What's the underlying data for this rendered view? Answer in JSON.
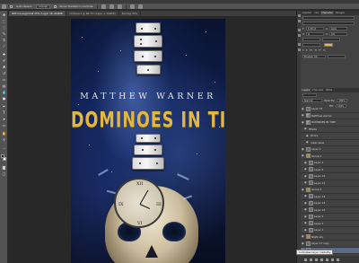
{
  "options_bar": {
    "auto_select_label": "Auto-Select:",
    "auto_select_value": "Group",
    "show_transform_label": "Show Transform Controls"
  },
  "doc_tabs": [
    "DEF-Covergold-W 25% (Layer 16, RGB/8)",
    "Untitled-1 @ 66.7% (Layer 1, RGB/8)",
    "Sunday 33%"
  ],
  "cover": {
    "author": "MATTHEW WARNER",
    "title": "DOMINOES IN TIME",
    "accent_color": "#e2b843"
  },
  "panels": {
    "top_tabs": [
      "Adjustm",
      "Info",
      "Character",
      "Paragra"
    ],
    "active_top_tab": "Character",
    "size_field": "5.26 pt",
    "leading_field": "Auto",
    "tracking_field": "0",
    "kerning_field": "0%",
    "language": "English: UK",
    "layer_tabs": [
      "Layers",
      "Channels",
      "Paths"
    ],
    "blend_mode": "Normal",
    "opacity_label": "Opacity:",
    "opacity_value": "100%",
    "fill_label": "Fill:",
    "fill_value": "100%"
  },
  "layers": [
    "Layer 15",
    "Matthew warner",
    "DOMINOES IN TIME",
    "Effects",
    "Stroke",
    "Outer Glow",
    "Layer 1",
    "Group 1",
    "Layer 1",
    "Layer 5",
    "Layer 12",
    "Layer 11",
    "Group 2",
    "Layer 12",
    "Layer 13",
    "Layer 14",
    "Layer 9",
    "Layer 6",
    "Layer 1",
    "Night sky",
    "Layer 17 copy",
    "Layer 13 copy"
  ],
  "selected_layer_index": 21,
  "tooltip": "Indicates layer visibility"
}
